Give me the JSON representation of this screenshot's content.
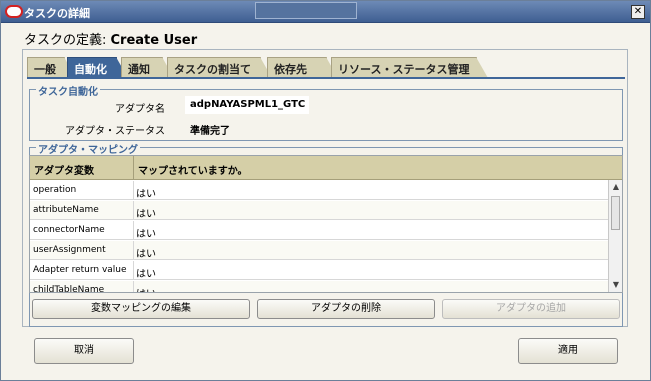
{
  "window": {
    "title": "タスクの詳細",
    "close_glyph": "✕"
  },
  "heading": {
    "prefix": "タスクの定義: ",
    "name": "Create User"
  },
  "tabs": [
    {
      "label": "一般",
      "active": false
    },
    {
      "label": "自動化",
      "active": true
    },
    {
      "label": "通知",
      "active": false
    },
    {
      "label": "タスクの割当て",
      "active": false
    },
    {
      "label": "依存先",
      "active": false
    },
    {
      "label": "リソース・ステータス管理",
      "active": false
    }
  ],
  "task_automation": {
    "legend": "タスク自動化",
    "adapter_name_label": "アダプタ名",
    "adapter_name_value": "adpNAYASPML1_GTC",
    "adapter_status_label": "アダプタ・ステータス",
    "adapter_status_value": "準備完了"
  },
  "adapter_mapping": {
    "legend": "アダプタ・マッピング",
    "columns": [
      "アダプタ変数",
      "マップされていますか。"
    ],
    "rows": [
      {
        "variable": "operation",
        "mapped": "はい"
      },
      {
        "variable": "attributeName",
        "mapped": "はい"
      },
      {
        "variable": "connectorName",
        "mapped": "はい"
      },
      {
        "variable": "userAssignment",
        "mapped": "はい"
      },
      {
        "variable": "Adapter return value",
        "mapped": "はい"
      },
      {
        "variable": "childTableName",
        "mapped": "はい"
      }
    ]
  },
  "buttons": {
    "edit_mapping": "変数マッピングの編集",
    "delete_adapter": "アダプタの削除",
    "add_adapter": "アダプタの追加",
    "cancel": "取消",
    "apply": "適用"
  }
}
